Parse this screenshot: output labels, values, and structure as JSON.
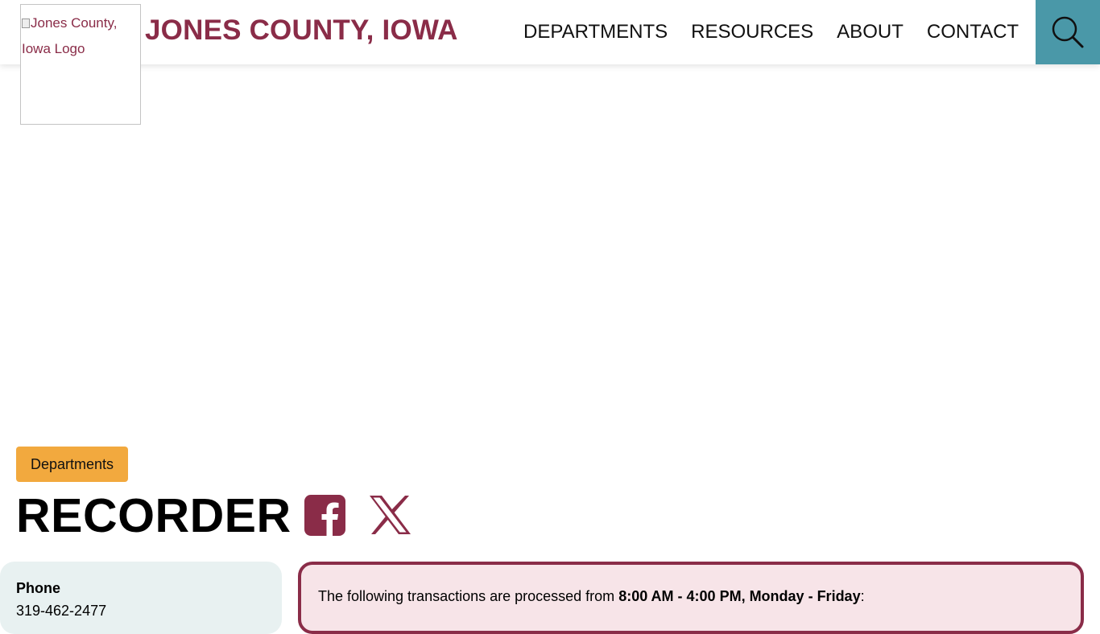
{
  "header": {
    "logo_alt": "Jones County, Iowa Logo",
    "site_title": "JONES COUNTY, IOWA",
    "nav": [
      {
        "label": "DEPARTMENTS"
      },
      {
        "label": "RESOURCES"
      },
      {
        "label": "ABOUT"
      },
      {
        "label": "CONTACT"
      }
    ],
    "search_icon": "search-icon"
  },
  "breadcrumb_button": "Departments",
  "page_title": "RECORDER",
  "social": [
    {
      "name": "facebook-icon"
    },
    {
      "name": "x-icon"
    }
  ],
  "contact": {
    "phone_label": "Phone",
    "phone_value": "319-462-2477"
  },
  "notice": {
    "prefix": "The following transactions are processed from ",
    "hours": "8:00 AM - 4:00 PM, Monday - Friday",
    "suffix": ":"
  },
  "colors": {
    "brand": "#8a2c48",
    "search_bg": "#4a98a8",
    "button_bg": "#f2a93e",
    "contact_bg": "#e8f1f1",
    "notice_bg": "#f7e4e8"
  }
}
